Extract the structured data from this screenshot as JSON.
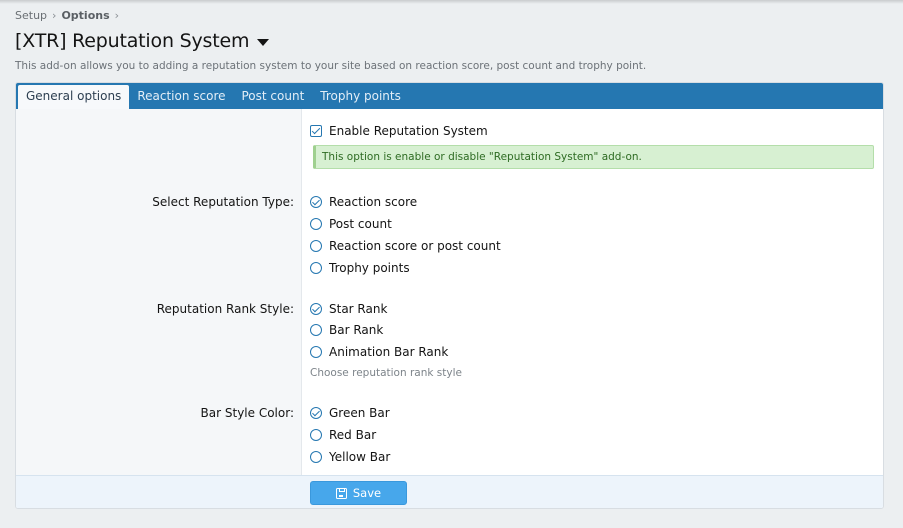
{
  "breadcrumb": {
    "items": [
      "Setup",
      "Options"
    ]
  },
  "page": {
    "title": "[XTR] Reputation System",
    "description": "This add-on allows you to adding a reputation system to your site based on reaction score, post count and trophy point."
  },
  "tabs": [
    {
      "label": "General options",
      "active": true
    },
    {
      "label": "Reaction score",
      "active": false
    },
    {
      "label": "Post count",
      "active": false
    },
    {
      "label": "Trophy points",
      "active": false
    }
  ],
  "enable": {
    "label": "Enable Reputation System",
    "checked": true,
    "notice": "This option is enable or disable \"Reputation System\" add-on."
  },
  "reputation_type": {
    "label": "Select Reputation Type:",
    "options": [
      "Reaction score",
      "Post count",
      "Reaction score or post count",
      "Trophy points"
    ],
    "selected": "Reaction score"
  },
  "rank_style": {
    "label": "Reputation Rank Style:",
    "options": [
      "Star Rank",
      "Bar Rank",
      "Animation Bar Rank"
    ],
    "selected": "Star Rank",
    "hint": "Choose reputation rank style"
  },
  "bar_color": {
    "label": "Bar Style Color:",
    "options": [
      "Green Bar",
      "Red Bar",
      "Yellow Bar"
    ],
    "selected": "Green Bar"
  },
  "footer": {
    "save_label": "Save"
  },
  "colors": {
    "accent": "#2577b1",
    "button": "#47a7eb",
    "notice_bg": "#d7f0d2"
  }
}
